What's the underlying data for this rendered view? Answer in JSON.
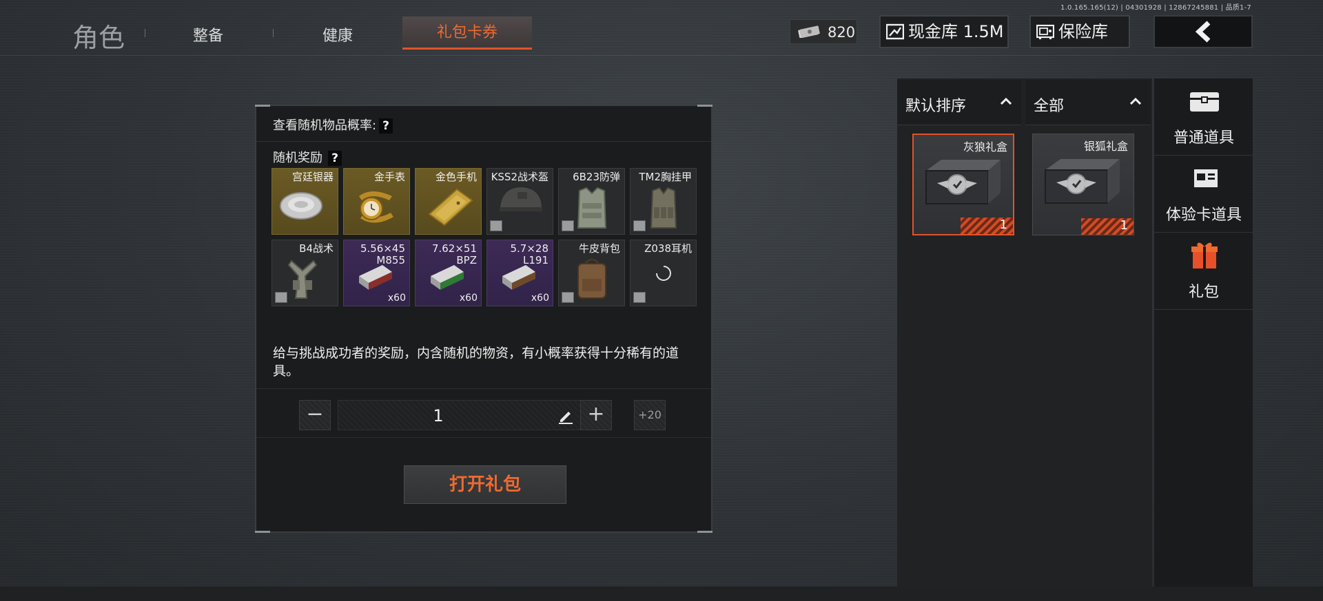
{
  "version": "1.0.165.165(12) | 04301928 | 12867245881 | 品质1-7",
  "nav": {
    "title": "角色",
    "tabs": [
      "整备",
      "健康",
      "礼包卡券"
    ],
    "active_tab": "礼包卡券",
    "cash_value": "820",
    "cash_vault_label": "现金库 1.5M",
    "safe_label": "保险库"
  },
  "panel": {
    "prob_label": "查看随机物品概率:",
    "reward_label": "随机奖励",
    "help_mark": "?",
    "items": [
      {
        "name": "宫廷银器",
        "rarity": "gold",
        "qty": ""
      },
      {
        "name": "金手表",
        "rarity": "gold",
        "qty": ""
      },
      {
        "name": "金色手机",
        "rarity": "gold",
        "qty": ""
      },
      {
        "name": "KSS2战术盔",
        "rarity": "gray",
        "qty": ""
      },
      {
        "name": "6B23防弹",
        "rarity": "gray",
        "qty": ""
      },
      {
        "name": "TM2胸挂甲",
        "rarity": "gray",
        "qty": ""
      },
      {
        "name": "B4战术",
        "rarity": "gray",
        "qty": ""
      },
      {
        "name": "5.56×45 M855",
        "rarity": "purple",
        "qty": "x60"
      },
      {
        "name": "7.62×51 BPZ",
        "rarity": "purple",
        "qty": "x60"
      },
      {
        "name": "5.7×28 L191",
        "rarity": "purple",
        "qty": "x60"
      },
      {
        "name": "牛皮背包",
        "rarity": "gray",
        "qty": ""
      },
      {
        "name": "Z038耳机",
        "rarity": "gray",
        "qty": ""
      }
    ],
    "description": "给与挑战成功者的奖励，内含随机的物资，有小概率获得十分稀有的道具。",
    "quantity": "1",
    "minus": "−",
    "plus": "+",
    "plus20": "+20",
    "open_button": "打开礼包"
  },
  "sort": {
    "order_label": "默认排序",
    "filter_label": "全部"
  },
  "gifts": [
    {
      "name": "灰狼礼盒",
      "qty": "1",
      "selected": true
    },
    {
      "name": "银狐礼盒",
      "qty": "1",
      "selected": false
    }
  ],
  "side_tabs": [
    {
      "label": "普通道具",
      "icon": "chest-icon",
      "active": false
    },
    {
      "label": "体验卡道具",
      "icon": "card-icon",
      "active": false
    },
    {
      "label": "礼包",
      "icon": "gift-icon",
      "active": true
    }
  ],
  "colors": {
    "accent": "#f06a2e",
    "gold_cell": "#6b5a24",
    "purple_cell": "#3d2a55"
  }
}
